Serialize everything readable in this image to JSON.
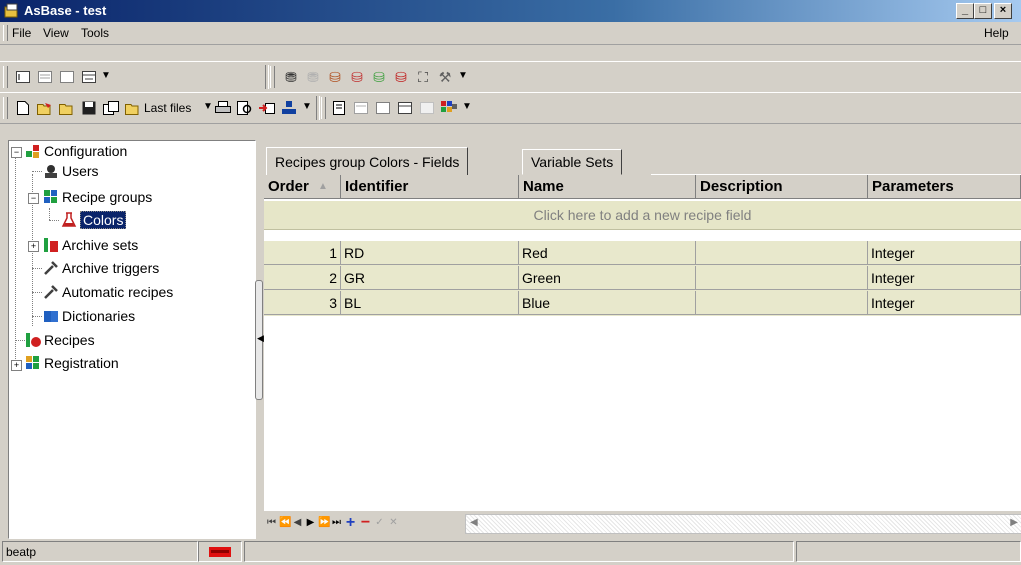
{
  "window": {
    "title": "AsBase - test",
    "controls": [
      "_",
      "□",
      "×"
    ],
    "icon": "app-icon"
  },
  "menu": {
    "file": "File",
    "view": "View",
    "tools": "Tools",
    "help": "Help"
  },
  "toolbar": {
    "last_files": "Last files"
  },
  "tree": {
    "items": [
      {
        "label": "Configuration",
        "icon": "configuration-icon"
      },
      {
        "label": "Users",
        "icon": "users-icon"
      },
      {
        "label": "Recipe groups",
        "icon": "recipe-groups-icon"
      },
      {
        "label": "Colors",
        "icon": "flask-icon"
      },
      {
        "label": "Archive sets",
        "icon": "archive-sets-icon"
      },
      {
        "label": "Archive triggers",
        "icon": "wrench-icon"
      },
      {
        "label": "Automatic recipes",
        "icon": "wrench-icon"
      },
      {
        "label": "Dictionaries",
        "icon": "book-icon"
      },
      {
        "label": "Recipes",
        "icon": "recipes-icon"
      },
      {
        "label": "Registration",
        "icon": "registration-icon"
      }
    ]
  },
  "tabs": [
    {
      "label": "Recipes group Colors - Fields"
    },
    {
      "label": "Variable Sets"
    }
  ],
  "grid": {
    "columns": [
      "Order",
      "Identifier",
      "Name",
      "Description",
      "Parameters"
    ],
    "add_row_text": "Click here to add a new recipe field",
    "rows": [
      {
        "order": "1",
        "identifier": "RD",
        "name": "Red",
        "description": "",
        "parameters": "Integer"
      },
      {
        "order": "2",
        "identifier": "GR",
        "name": "Green",
        "description": "",
        "parameters": "Integer"
      },
      {
        "order": "3",
        "identifier": "BL",
        "name": "Blue",
        "description": "",
        "parameters": "Integer"
      }
    ]
  },
  "status": {
    "user": "beatp"
  },
  "colors": {
    "title_bar": "#0a246a",
    "grid_row": "#e8e8cc",
    "selection": "#0a246a"
  }
}
